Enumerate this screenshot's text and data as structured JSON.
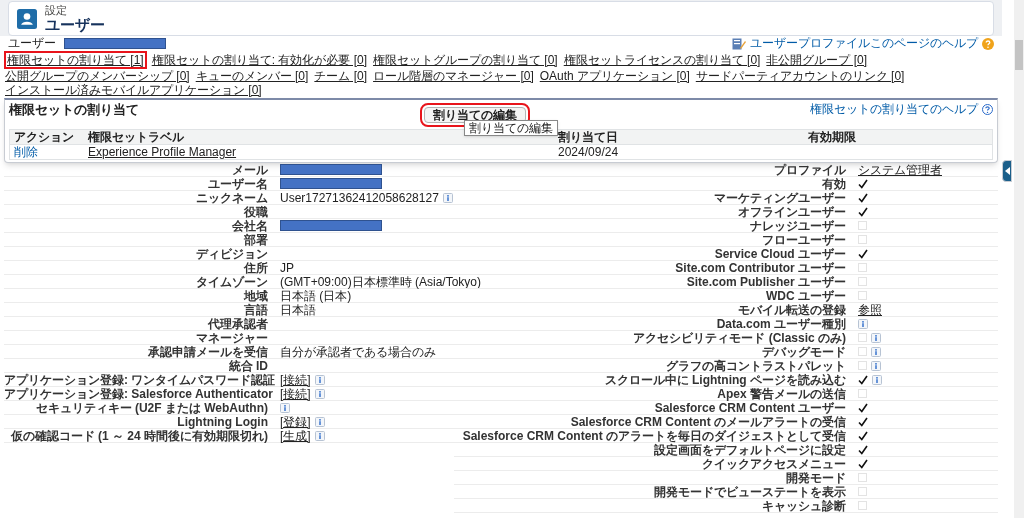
{
  "header": {
    "section": "設定",
    "title": "ユーザー"
  },
  "user": {
    "label": "ユーザー",
    "redacted": true
  },
  "help_link": "ユーザープロファイルこのページのヘルプ",
  "tabs": [
    {
      "label": "権限セットの割り当て [1]",
      "highlighted": true
    },
    {
      "label": "権限セットの割り当て: 有効化が必要 [0]",
      "highlighted": false
    },
    {
      "label": "権限セットグループの割り当て [0]",
      "highlighted": false
    },
    {
      "label": "権限セットライセンスの割り当て [0]",
      "highlighted": false
    },
    {
      "label": "非公開グループ [0]",
      "highlighted": false
    },
    {
      "label": "公開グループのメンバーシップ [0]",
      "highlighted": false
    },
    {
      "label": "キューのメンバー [0]",
      "highlighted": false
    },
    {
      "label": "チーム [0]",
      "highlighted": false
    },
    {
      "label": "ロール階層のマネージャー [0]",
      "highlighted": false
    },
    {
      "label": "OAuth アプリケーション [0]",
      "highlighted": false
    },
    {
      "label": "サードパーティアカウントのリンク [0]",
      "highlighted": false
    },
    {
      "label": "インストール済みモバイルアプリケーション [0]",
      "highlighted": false
    }
  ],
  "assignment_panel": {
    "title": "権限セットの割り当て",
    "edit_button": {
      "label": "割り当ての編集",
      "highlighted": true
    },
    "tooltip": "割り当ての編集",
    "help_link": "権限セットの割り当てのヘルプ",
    "columns": [
      "アクション",
      "権限セットラベル",
      "割り当て日",
      "有効期限"
    ],
    "rows": [
      {
        "action": "削除",
        "label": "Experience Profile Manager",
        "date": "2024/09/24"
      }
    ]
  },
  "details_left": [
    {
      "label": "メール",
      "redacted": true
    },
    {
      "label": "ユーザー名",
      "redacted": true
    },
    {
      "label": "ニックネーム",
      "value": "User17271362412058628127",
      "info": true
    },
    {
      "label": "役職"
    },
    {
      "label": "会社名",
      "redacted": true
    },
    {
      "label": "部署"
    },
    {
      "label": "ディビジョン"
    },
    {
      "label": "住所",
      "value": "JP"
    },
    {
      "label": "タイムゾーン",
      "value": "(GMT+09:00)日本標準時 (Asia/Tokyo)"
    },
    {
      "label": "地域",
      "value": "日本語 (日本)"
    },
    {
      "label": "言語",
      "value": "日本語"
    },
    {
      "label": "代理承認者"
    },
    {
      "label": "マネージャー"
    },
    {
      "label": "承認申請メールを受信",
      "value": "自分が承認者である場合のみ"
    },
    {
      "label": "統合 ID"
    },
    {
      "label": "アプリケーション登録: ワンタイムパスワード認証",
      "action": "[接続]",
      "info": true
    },
    {
      "label": "アプリケーション登録: Salesforce Authenticator",
      "action": "[接続]",
      "info": true
    },
    {
      "label": "セキュリティキー (U2F または WebAuthn)",
      "info": true
    },
    {
      "label": "Lightning Login",
      "action": "[登録]",
      "info": true
    },
    {
      "label": "仮の確認コード (1 ～ 24 時間後に有効期限切れ)",
      "action": "[生成]",
      "info": true
    }
  ],
  "details_right": [
    {
      "label": "プロファイル",
      "kind": "link",
      "value": "システム管理者"
    },
    {
      "label": "有効",
      "kind": "check",
      "checked": true
    },
    {
      "label": "マーケティングユーザー",
      "kind": "check",
      "checked": true
    },
    {
      "label": "オフラインユーザー",
      "kind": "check",
      "checked": true
    },
    {
      "label": "ナレッジユーザー",
      "kind": "check",
      "checked": false
    },
    {
      "label": "フローユーザー",
      "kind": "check",
      "checked": false
    },
    {
      "label": "Service Cloud ユーザー",
      "kind": "check",
      "checked": true
    },
    {
      "label": "Site.com Contributor ユーザー",
      "kind": "check",
      "checked": false
    },
    {
      "label": "Site.com Publisher ユーザー",
      "kind": "check",
      "checked": false
    },
    {
      "label": "WDC ユーザー",
      "kind": "check",
      "checked": false
    },
    {
      "label": "モバイル転送の登録",
      "kind": "link",
      "value": "参照"
    },
    {
      "label": "Data.com ユーザー種別",
      "kind": "info"
    },
    {
      "label": "アクセシビリティモード (Classic のみ)",
      "kind": "check",
      "checked": false,
      "info": true
    },
    {
      "label": "デバッグモード",
      "kind": "check",
      "checked": false,
      "info": true
    },
    {
      "label": "グラフの高コントラストパレット",
      "kind": "check",
      "checked": false,
      "info": true
    },
    {
      "label": "スクロール中に Lightning ページを読み込む",
      "kind": "check",
      "checked": true,
      "info": true
    },
    {
      "label": "Apex 警告メールの送信",
      "kind": "check",
      "checked": false
    },
    {
      "label": "Salesforce CRM Content ユーザー",
      "kind": "check",
      "checked": true
    },
    {
      "label": "Salesforce CRM Content のメールアラートの受信",
      "kind": "check",
      "checked": true
    },
    {
      "label": "Salesforce CRM Content のアラートを毎日のダイジェストとして受信",
      "kind": "check",
      "checked": true
    },
    {
      "label": "設定画面をデフォルトページに設定",
      "kind": "check",
      "checked": true
    },
    {
      "label": "クイックアクセスメニュー",
      "kind": "check",
      "checked": true
    },
    {
      "label": "開発モード",
      "kind": "check",
      "checked": false
    },
    {
      "label": "開発モードでビューステートを表示",
      "kind": "check",
      "checked": false
    },
    {
      "label": "キャッシュ診断",
      "kind": "check",
      "checked": false
    }
  ]
}
